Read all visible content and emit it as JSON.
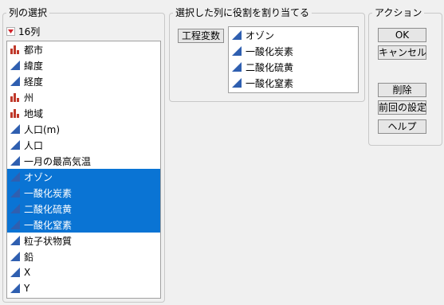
{
  "column_select": {
    "title": "列の選択",
    "count_label": "16列",
    "items": [
      {
        "label": "都市",
        "icon": "nominal-bar-icon",
        "selected": false
      },
      {
        "label": "緯度",
        "icon": "continuous-triangle-icon",
        "selected": false
      },
      {
        "label": "経度",
        "icon": "continuous-triangle-icon",
        "selected": false
      },
      {
        "label": "州",
        "icon": "nominal-bar-icon",
        "selected": false
      },
      {
        "label": "地域",
        "icon": "nominal-bar-icon",
        "selected": false
      },
      {
        "label": "人口(m)",
        "icon": "continuous-triangle-icon",
        "selected": false
      },
      {
        "label": "人口",
        "icon": "continuous-triangle-icon",
        "selected": false
      },
      {
        "label": "一月の最高気温",
        "icon": "continuous-triangle-icon",
        "selected": false
      },
      {
        "label": "オゾン",
        "icon": "continuous-triangle-icon",
        "selected": true
      },
      {
        "label": "一酸化炭素",
        "icon": "continuous-triangle-icon",
        "selected": true
      },
      {
        "label": "二酸化硫黄",
        "icon": "continuous-triangle-icon",
        "selected": true
      },
      {
        "label": "一酸化窒素",
        "icon": "continuous-triangle-icon",
        "selected": true
      },
      {
        "label": "粒子状物質",
        "icon": "continuous-triangle-icon",
        "selected": false
      },
      {
        "label": "鉛",
        "icon": "continuous-triangle-icon",
        "selected": false
      },
      {
        "label": "X",
        "icon": "continuous-triangle-icon",
        "selected": false
      },
      {
        "label": "Y",
        "icon": "continuous-triangle-icon",
        "selected": false
      }
    ]
  },
  "assign_roles": {
    "title": "選択した列に役割を割り当てる",
    "role_button": "工程変数",
    "items": [
      {
        "label": "オゾン",
        "icon": "continuous-triangle-icon"
      },
      {
        "label": "一酸化炭素",
        "icon": "continuous-triangle-icon"
      },
      {
        "label": "二酸化硫黄",
        "icon": "continuous-triangle-icon"
      },
      {
        "label": "一酸化窒素",
        "icon": "continuous-triangle-icon"
      }
    ]
  },
  "actions": {
    "title": "アクション",
    "ok": "OK",
    "cancel": "キャンセル",
    "remove": "削除",
    "recall": "前回の設定",
    "help": "ヘルプ"
  },
  "colors": {
    "selection": "#0a74d4",
    "continuous_icon": "#2f5fb0",
    "nominal_icon": "#c0392b",
    "dropdown_triangle": "#d2232a"
  }
}
